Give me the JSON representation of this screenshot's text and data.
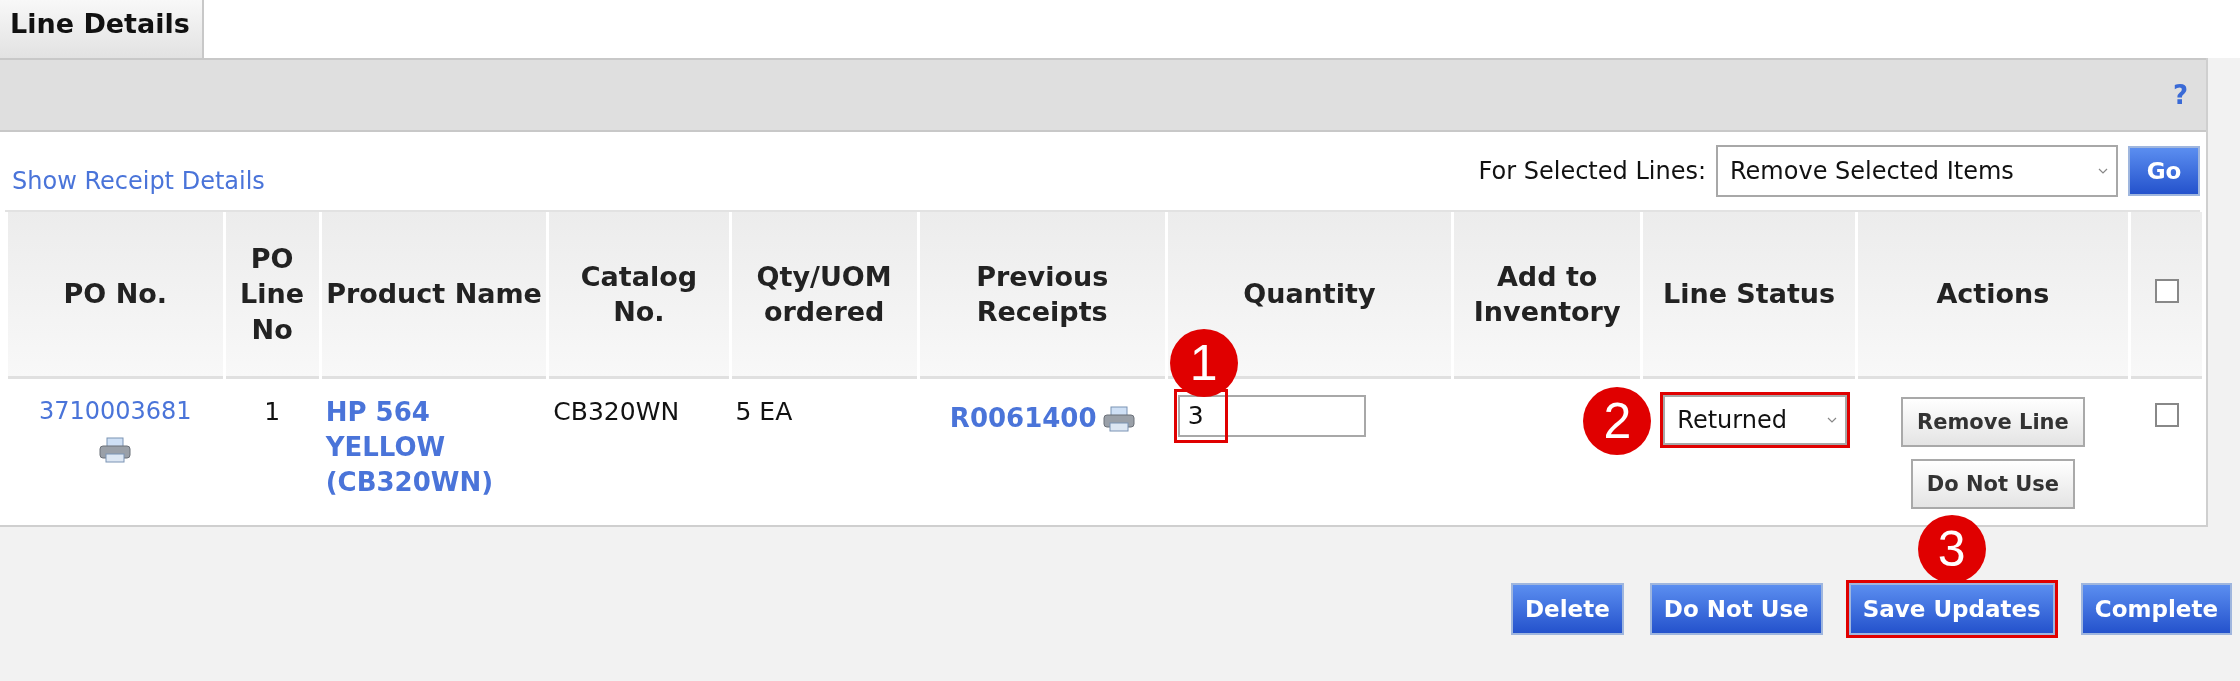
{
  "tabs": [
    {
      "label": "Line Details",
      "selected": true
    }
  ],
  "help": "?",
  "toolbar": {
    "link": "Show Receipt Details",
    "bulk_label": "For Selected Lines:",
    "bulk_value": "Remove Selected Items",
    "go": "Go"
  },
  "table": {
    "columns": [
      "PO No.",
      "PO Line No",
      "Product Name",
      "Catalog No.",
      "Qty/UOM ordered",
      "Previous Receipts",
      "Quantity",
      "Add to Inventory",
      "Line Status",
      "Actions"
    ],
    "select_all_checked": false,
    "rows": [
      {
        "po_no": "3710003681",
        "line_no": "1",
        "product": "HP 564 YELLOW (CB320WN)",
        "catalog": "CB320WN",
        "qty_uom": "5 EA",
        "receipt": "R0061400",
        "quantity": {
          "value": "3",
          "highlighted": true,
          "marker": "1"
        },
        "line_status": {
          "value": "Returned",
          "highlighted": true,
          "marker": "2"
        },
        "actions": [
          "Remove Line",
          "Do Not Use"
        ],
        "checked": false
      }
    ]
  },
  "buttons": [
    {
      "label": "Delete",
      "highlighted": false
    },
    {
      "label": "Do Not Use",
      "highlighted": false
    },
    {
      "label": "Save Updates",
      "highlighted": true,
      "marker": "3"
    },
    {
      "label": "Complete",
      "highlighted": false
    }
  ]
}
